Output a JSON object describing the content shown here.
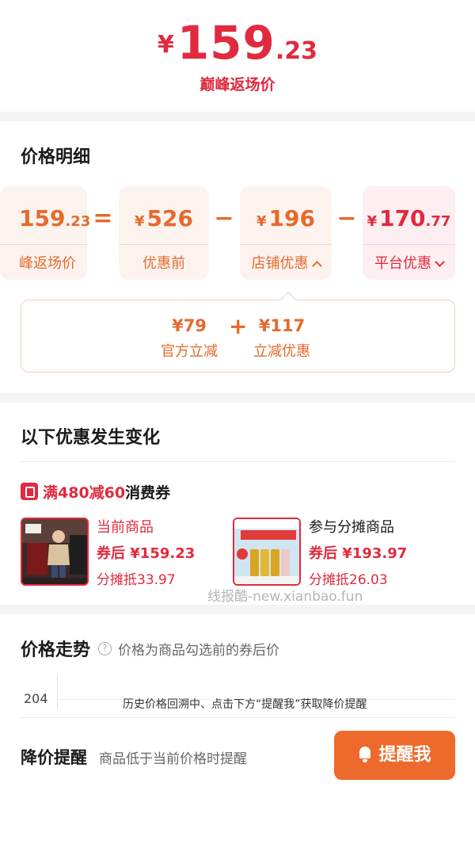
{
  "header": {
    "yen": "¥",
    "price_int": "159",
    "price_dec": ".23",
    "caption": "巅峰返场价"
  },
  "breakdown": {
    "title": "价格明细",
    "final": {
      "yen": "",
      "int": "159",
      "dec": ".23",
      "label": "峰返场价"
    },
    "equals": "=",
    "minus": "−",
    "before": {
      "yen": "¥",
      "int": "526",
      "dec": "",
      "label": "优惠前"
    },
    "store": {
      "yen": "¥",
      "int": "196",
      "dec": "",
      "label": "店铺优惠"
    },
    "platform": {
      "yen": "¥",
      "int": "170",
      "dec": ".77",
      "label": "平台优惠"
    },
    "store_detail": [
      {
        "value": "¥79",
        "label": "官方立减"
      },
      {
        "value": "¥117",
        "label": "立减优惠"
      }
    ],
    "plus": "+"
  },
  "changes": {
    "title": "以下优惠发生变化",
    "coupon": {
      "highlight": "满480减60",
      "rest": "消费券"
    },
    "products": [
      {
        "name": "当前商品",
        "price": "券后 ¥159.23",
        "share": "分摊抵33.97",
        "thumb": "clothing-photo"
      },
      {
        "name": "参与分摊商品",
        "price": "券后 ¥193.97",
        "share": "分摊抵26.03",
        "thumb": "haircare-photo"
      }
    ]
  },
  "watermark": "线报酷-new.xianbao.fun",
  "trend": {
    "title": "价格走势",
    "subtitle": "价格为商品勾选前的券后价",
    "help": "?",
    "y_tick": "204",
    "message": "历史价格回溯中、点击下方“提醒我”获取降价提醒"
  },
  "reminder": {
    "title": "降价提醒",
    "subtitle": "商品低于当前价格时提醒",
    "button": "提醒我"
  },
  "colors": {
    "red": "#e02a3f",
    "orange": "#e46a2c",
    "button": "#ed6a2c"
  }
}
